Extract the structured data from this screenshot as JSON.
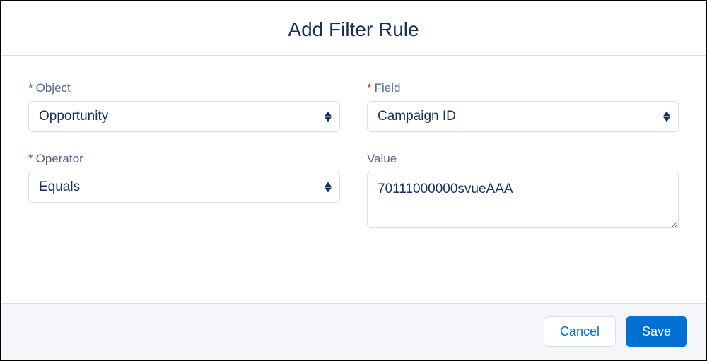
{
  "header": {
    "title": "Add Filter Rule"
  },
  "form": {
    "object": {
      "label": "Object",
      "value": "Opportunity",
      "required": true
    },
    "field": {
      "label": "Field",
      "value": "Campaign ID",
      "required": true
    },
    "operator": {
      "label": "Operator",
      "value": "Equals",
      "required": true
    },
    "value": {
      "label": "Value",
      "value": "70111000000svueAAA",
      "required": false
    }
  },
  "footer": {
    "cancel": "Cancel",
    "save": "Save"
  }
}
